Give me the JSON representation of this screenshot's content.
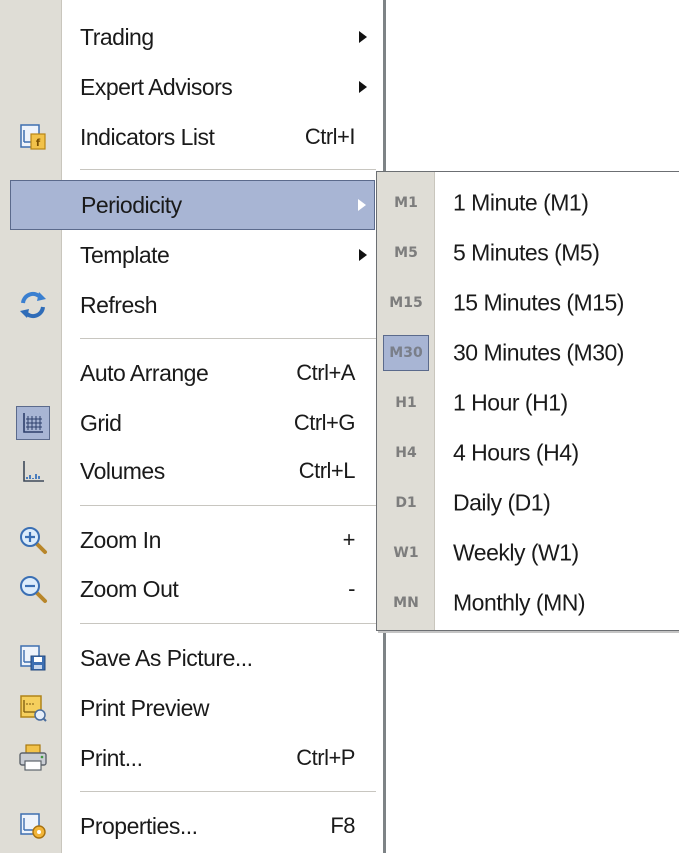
{
  "menu": {
    "items": [
      {
        "label": "Trading",
        "shortcut": "",
        "submenu": true,
        "icon": ""
      },
      {
        "label": "Expert Advisors",
        "shortcut": "",
        "submenu": true,
        "icon": ""
      },
      {
        "label": "Indicators List",
        "shortcut": "Ctrl+I",
        "submenu": false,
        "icon": "indicators-list-icon"
      },
      {
        "label": "Periodicity",
        "shortcut": "",
        "submenu": true,
        "icon": "",
        "highlighted": true
      },
      {
        "label": "Template",
        "shortcut": "",
        "submenu": true,
        "icon": ""
      },
      {
        "label": "Refresh",
        "shortcut": "",
        "submenu": false,
        "icon": "refresh-icon"
      },
      {
        "label": "Auto Arrange",
        "shortcut": "Ctrl+A",
        "submenu": false,
        "icon": ""
      },
      {
        "label": "Grid",
        "shortcut": "Ctrl+G",
        "submenu": false,
        "icon": "grid-icon",
        "checked": true
      },
      {
        "label": "Volumes",
        "shortcut": "Ctrl+L",
        "submenu": false,
        "icon": "volumes-icon"
      },
      {
        "label": "Zoom In",
        "shortcut": "+",
        "submenu": false,
        "icon": "zoom-in-icon"
      },
      {
        "label": "Zoom Out",
        "shortcut": "-",
        "submenu": false,
        "icon": "zoom-out-icon"
      },
      {
        "label": "Save As Picture...",
        "shortcut": "",
        "submenu": false,
        "icon": "save-picture-icon"
      },
      {
        "label": "Print Preview",
        "shortcut": "",
        "submenu": false,
        "icon": "print-preview-icon"
      },
      {
        "label": "Print...",
        "shortcut": "Ctrl+P",
        "submenu": false,
        "icon": "printer-icon"
      },
      {
        "label": "Properties...",
        "shortcut": "F8",
        "submenu": false,
        "icon": "properties-icon"
      }
    ]
  },
  "periodicity_submenu": {
    "items": [
      {
        "code": "M1",
        "label": "1 Minute (M1)"
      },
      {
        "code": "M5",
        "label": "5 Minutes (M5)"
      },
      {
        "code": "M15",
        "label": "15 Minutes (M15)"
      },
      {
        "code": "M30",
        "label": "30 Minutes (M30)",
        "active": true
      },
      {
        "code": "H1",
        "label": "1 Hour (H1)"
      },
      {
        "code": "H4",
        "label": "4 Hours (H4)"
      },
      {
        "code": "D1",
        "label": "Daily (D1)"
      },
      {
        "code": "W1",
        "label": "Weekly (W1)"
      },
      {
        "code": "MN",
        "label": "Monthly (MN)"
      }
    ]
  },
  "colors": {
    "highlight": "#a8b5d4",
    "highlight_border": "#5b6a8c",
    "gutter": "#dfddd6",
    "text": "#1a1a1a"
  }
}
